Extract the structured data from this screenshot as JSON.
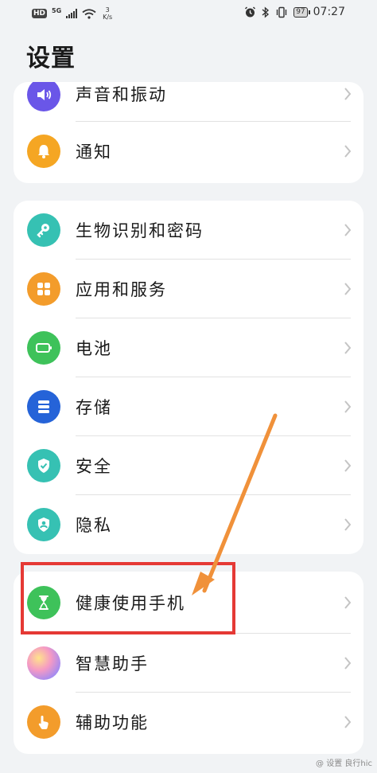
{
  "status_bar": {
    "hd": "HD",
    "network": "5G",
    "speed_value": "3",
    "speed_unit": "K/s",
    "battery": "97",
    "time": "07:27"
  },
  "page": {
    "title": "设置"
  },
  "groups": [
    {
      "items": [
        {
          "label": "声音和振动",
          "icon": "speaker-icon",
          "color": "#6a56e8"
        },
        {
          "label": "通知",
          "icon": "bell-icon",
          "color": "#f5a623"
        }
      ]
    },
    {
      "items": [
        {
          "label": "生物识别和密码",
          "icon": "key-icon",
          "color": "#36c1b3"
        },
        {
          "label": "应用和服务",
          "icon": "apps-grid-icon",
          "color": "#f39c2b"
        },
        {
          "label": "电池",
          "icon": "battery-icon",
          "color": "#3ec25a"
        },
        {
          "label": "存储",
          "icon": "storage-icon",
          "color": "#2563d8"
        },
        {
          "label": "安全",
          "icon": "shield-check-icon",
          "color": "#36c1b3"
        },
        {
          "label": "隐私",
          "icon": "privacy-shield-icon",
          "color": "#36c1b3"
        }
      ]
    },
    {
      "items": [
        {
          "label": "健康使用手机",
          "icon": "hourglass-icon",
          "color": "#3ec25a"
        },
        {
          "label": "智慧助手",
          "icon": "assistant-orb-icon",
          "color": "#e58fd0"
        },
        {
          "label": "辅助功能",
          "icon": "hand-pointer-icon",
          "color": "#f39c2b"
        }
      ]
    }
  ],
  "watermark": "@ 设置 良行hic"
}
